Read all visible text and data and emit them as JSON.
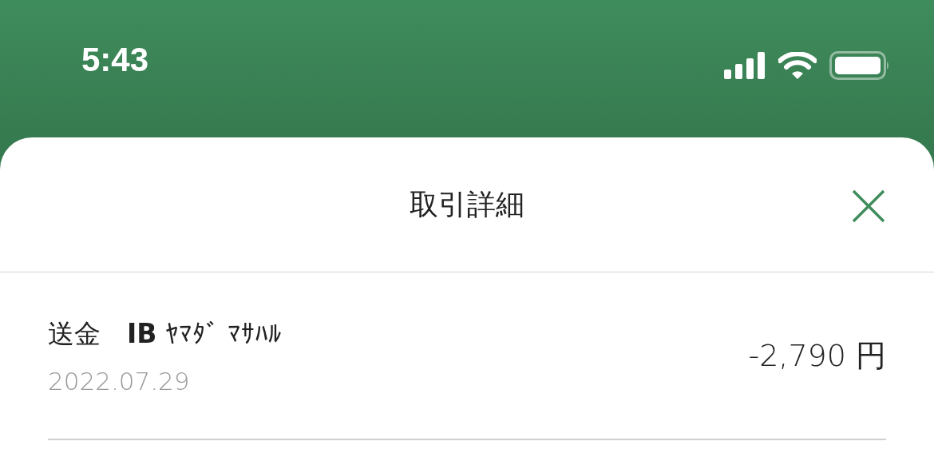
{
  "status_bar": {
    "time": "5:43"
  },
  "sheet": {
    "title": "取引詳細"
  },
  "transaction": {
    "description": "送金　**IB** ﾔﾏﾀﾞ ﾏｻﾊﾙ",
    "date": "2022.07.29",
    "amount": "-2,790 円"
  }
}
